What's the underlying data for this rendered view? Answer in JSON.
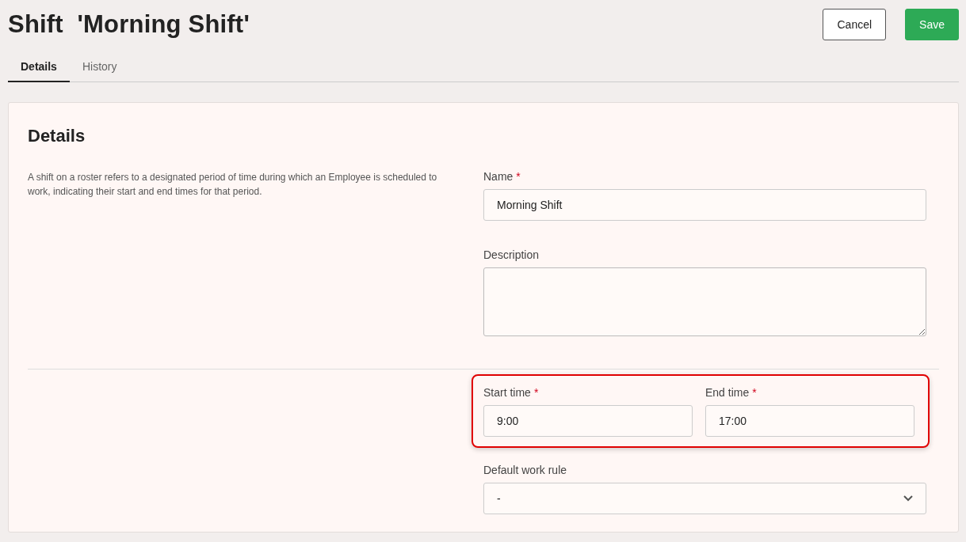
{
  "page": {
    "title": "Shift  'Morning Shift'"
  },
  "actions": [
    {
      "kind": "secondary",
      "label": "Cancel"
    },
    {
      "kind": "primary",
      "label": "Save"
    }
  ],
  "tabs": [
    {
      "label": "Details",
      "selected": true
    },
    {
      "label": "History",
      "selected": false
    }
  ],
  "form": {
    "section_title": "Details",
    "description": "A shift on a roster refers to a designated period of time during which an Employee is scheduled to work, indicating their start and end times for that period.",
    "fields": [
      {
        "kind": "text",
        "label": "Name",
        "required_mark": "*",
        "value": "Morning Shift"
      },
      {
        "kind": "textarea",
        "label": "Description"
      }
    ],
    "time_group": {
      "highlighted": true,
      "fields": [
        {
          "kind": "text",
          "label": "Start time",
          "required_mark": "*",
          "value": "9:00"
        },
        {
          "kind": "text",
          "label": "End time",
          "required_mark": "*",
          "value": "17:00"
        }
      ]
    },
    "more_fields": [
      {
        "kind": "select",
        "label": "Default work rule",
        "value": "-"
      }
    ]
  }
}
